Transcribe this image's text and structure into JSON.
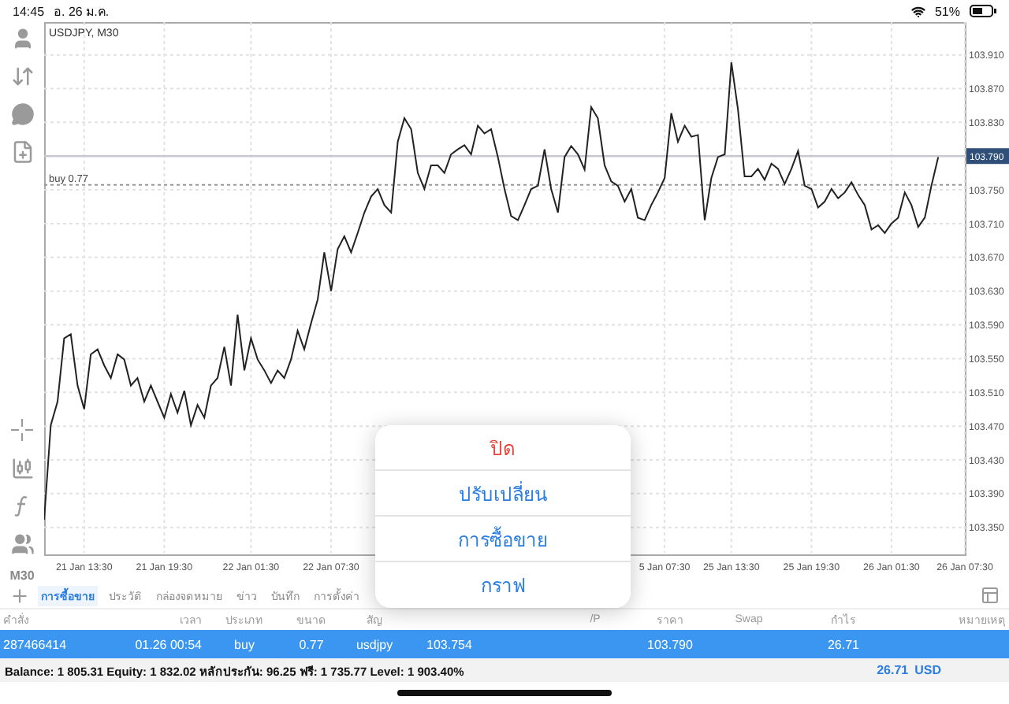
{
  "status_bar": {
    "time": "14:45",
    "date": "อ. 26 ม.ค.",
    "battery": "51%"
  },
  "toolbar": {
    "timeframe": "M30"
  },
  "chart": {
    "chart_data": {
      "type": "line",
      "title": "USDJPY, M30",
      "grid": true,
      "ylim": [
        103.318,
        103.947
      ],
      "categories": [
        null,
        null,
        null,
        null,
        null,
        null,
        "21 Jan 13:30",
        null,
        null,
        null,
        null,
        null,
        null,
        null,
        null,
        null,
        null,
        null,
        "21 Jan 19:30",
        null,
        null,
        null,
        null,
        null,
        null,
        null,
        null,
        null,
        null,
        null,
        null,
        "22 Jan 01:30",
        null,
        null,
        null,
        null,
        null,
        null,
        null,
        null,
        null,
        null,
        null,
        "22 Jan 07:30",
        null,
        null,
        null,
        null,
        null,
        null,
        null,
        null,
        null,
        null,
        null,
        null,
        null,
        null,
        null,
        null,
        null,
        null,
        null,
        null,
        null,
        null,
        null,
        null,
        null,
        null,
        null,
        null,
        null,
        null,
        null,
        null,
        null,
        null,
        null,
        null,
        null,
        null,
        null,
        null,
        null,
        null,
        null,
        null,
        null,
        null,
        null,
        null,
        null,
        "5 Jan 07:30",
        null,
        null,
        null,
        null,
        null,
        null,
        null,
        null,
        null,
        "25 Jan 13:30",
        null,
        null,
        null,
        null,
        null,
        null,
        null,
        null,
        null,
        null,
        null,
        "25 Jan 19:30",
        null,
        null,
        null,
        null,
        null,
        null,
        null,
        null,
        null,
        null,
        null,
        "26 Jan 01:30",
        null,
        null,
        null,
        null,
        null,
        null,
        null,
        null,
        null,
        null,
        "26 Jan 07:30"
      ],
      "yticks": [
        {
          "value": 103.35,
          "label": "103.350"
        },
        {
          "value": 103.39,
          "label": "103.390"
        },
        {
          "value": 103.43,
          "label": "103.430"
        },
        {
          "value": 103.47,
          "label": "103.470"
        },
        {
          "value": 103.51,
          "label": "103.510"
        },
        {
          "value": 103.55,
          "label": "103.550"
        },
        {
          "value": 103.59,
          "label": "103.590"
        },
        {
          "value": 103.63,
          "label": "103.630"
        },
        {
          "value": 103.67,
          "label": "103.670"
        },
        {
          "value": 103.71,
          "label": "103.710"
        },
        {
          "value": 103.75,
          "label": "103.750"
        },
        {
          "value": 103.83,
          "label": "103.830"
        },
        {
          "value": 103.87,
          "label": "103.870"
        },
        {
          "value": 103.91,
          "label": "103.910"
        }
      ],
      "series": [
        {
          "color": "#222222",
          "values": [
            103.359,
            103.471,
            103.499,
            103.574,
            103.579,
            103.518,
            103.49,
            103.555,
            103.561,
            103.542,
            103.527,
            103.555,
            103.549,
            103.518,
            103.527,
            103.499,
            103.518,
            103.499,
            103.48,
            103.508,
            103.486,
            103.512,
            103.471,
            103.495,
            103.48,
            103.518,
            103.527,
            103.564,
            103.518,
            103.602,
            103.536,
            103.574,
            103.549,
            103.536,
            103.521,
            103.536,
            103.527,
            103.549,
            103.583,
            103.561,
            103.592,
            103.62,
            103.676,
            103.63,
            103.68,
            103.695,
            103.676,
            103.699,
            103.723,
            103.742,
            103.751,
            103.732,
            103.723,
            103.807,
            103.835,
            103.822,
            103.77,
            103.751,
            103.779,
            103.779,
            103.77,
            103.792,
            103.798,
            103.803,
            103.792,
            103.826,
            103.817,
            103.822,
            103.789,
            103.751,
            103.719,
            103.714,
            103.732,
            103.751,
            103.755,
            103.798,
            103.751,
            103.723,
            103.789,
            103.802,
            103.792,
            103.774,
            103.848,
            103.835,
            103.779,
            103.76,
            103.755,
            103.736,
            103.751,
            103.717,
            103.714,
            103.732,
            103.747,
            103.764,
            103.841,
            103.807,
            103.826,
            103.813,
            103.815,
            103.714,
            103.764,
            103.789,
            103.792,
            103.901,
            103.845,
            103.766,
            103.766,
            103.775,
            103.762,
            103.781,
            103.775,
            103.757,
            103.775,
            103.796,
            103.755,
            103.751,
            103.729,
            103.736,
            103.751,
            103.74,
            103.747,
            103.759,
            103.744,
            103.732,
            103.703,
            103.708,
            103.699,
            103.71,
            103.717,
            103.747,
            103.732,
            103.706,
            103.717,
            103.755,
            103.789,
            null,
            null,
            null,
            null
          ]
        }
      ],
      "ref_lines": [
        {
          "axis": "y",
          "value": 103.79,
          "label": "103.790"
        },
        {
          "axis": "y",
          "value": 103.756,
          "label": "buy 0.77"
        }
      ]
    }
  },
  "tabs": [
    {
      "label": "การซื้อขาย",
      "selected": true
    },
    {
      "label": "ประวัติ",
      "selected": false
    },
    {
      "label": "กล่องจดหมาย",
      "selected": false
    },
    {
      "label": "ข่าว",
      "selected": false
    },
    {
      "label": "บันทึก",
      "selected": false
    },
    {
      "label": "การตั้งค่า",
      "selected": false
    }
  ],
  "table": {
    "columns": [
      "คำสั่ง",
      "เวลา",
      "ประเภท",
      "ขนาด",
      "สัญ",
      null,
      null,
      "/P",
      "ราคา",
      "Swap",
      "กำไร",
      "หมายเหตุ"
    ],
    "rows": [
      {
        "selected": true,
        "cells": [
          "287466414",
          "01.26 00:54",
          "buy",
          "0.77",
          "usdjpy",
          "103.754",
          null,
          null,
          "103.790",
          null,
          "26.71",
          null
        ]
      }
    ]
  },
  "summary": {
    "text": "Balance: 1 805.31 Equity: 1 832.02 หลักประกัน: 96.25 ฟรี: 1 735.77 Level: 1 903.40%",
    "profit": "26.71",
    "currency": "USD"
  },
  "context_menu": {
    "items": [
      {
        "label": "ปิด",
        "kind": "destructive"
      },
      {
        "label": "ปรับเปลี่ยน",
        "kind": "action"
      },
      {
        "label": "การซื้อขาย",
        "kind": "action"
      },
      {
        "label": "กราฟ",
        "kind": "action"
      }
    ]
  }
}
